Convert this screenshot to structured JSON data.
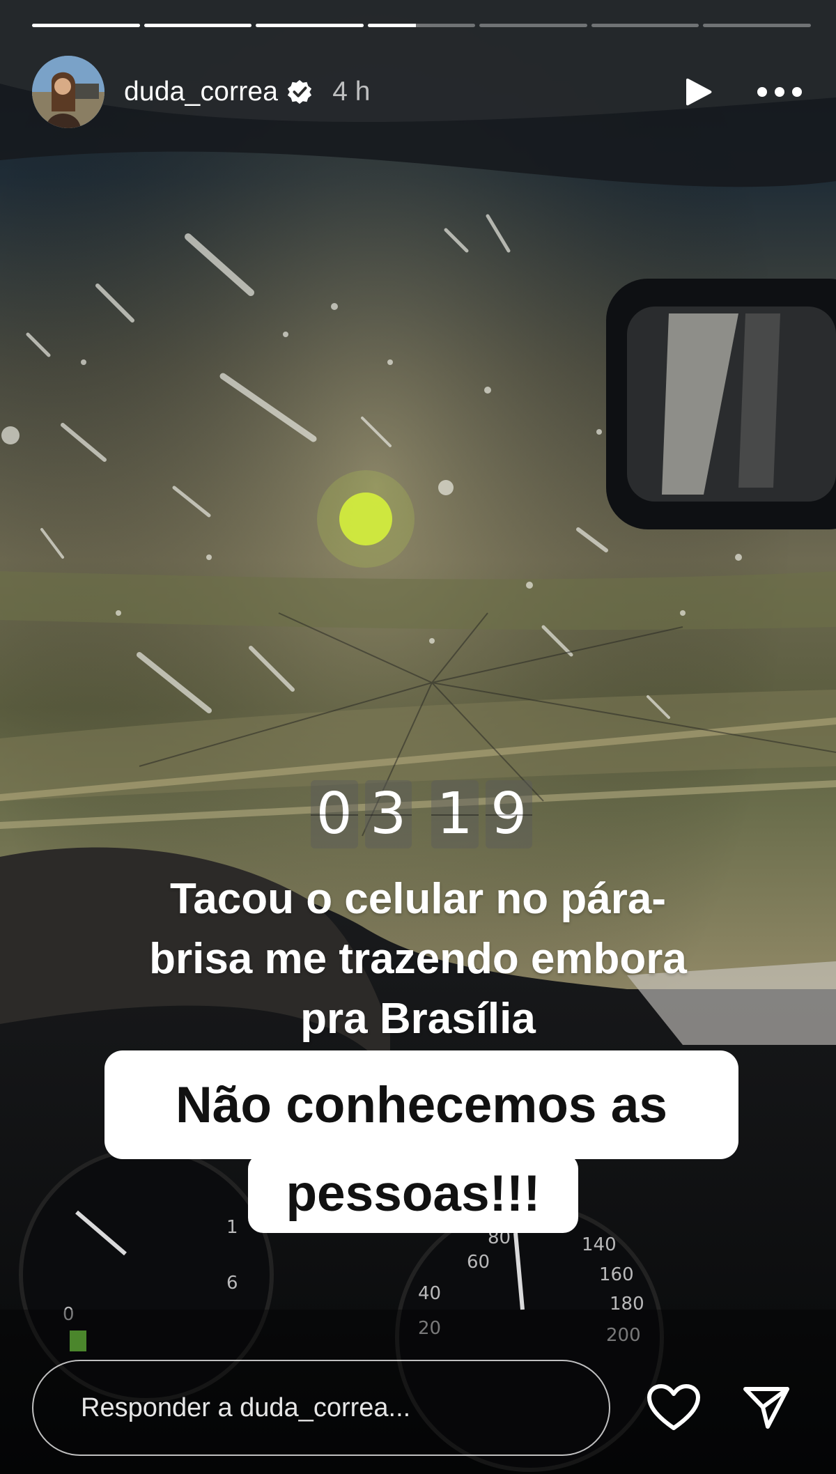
{
  "story": {
    "segments": 7,
    "current_segment_index": 3,
    "current_segment_progress": 0.45,
    "user": {
      "username": "duda_correa",
      "verified": true,
      "time_ago": "4 h"
    },
    "clock": {
      "digits": [
        "0",
        "3",
        "1",
        "9"
      ]
    },
    "caption": {
      "line1": "Tacou o celular no pára-",
      "line2": "brisa me trazendo embora",
      "line3": "pra Brasília"
    },
    "sticker": {
      "line1": "Não conhecemos as",
      "line2": "pessoas!!!"
    },
    "speedometer": {
      "labels": [
        "20",
        "40",
        "60",
        "80",
        "140",
        "160",
        "180",
        "200",
        "0",
        "1",
        "6"
      ]
    }
  },
  "footer": {
    "reply_placeholder": "Responder a duda_correa..."
  },
  "icons": [
    "verified-badge-icon",
    "play-icon",
    "more-options-icon",
    "heart-icon",
    "send-icon"
  ],
  "colors": {
    "text": "#ffffff",
    "sticker_bg": "#ffffff",
    "sticker_text": "#111111"
  }
}
